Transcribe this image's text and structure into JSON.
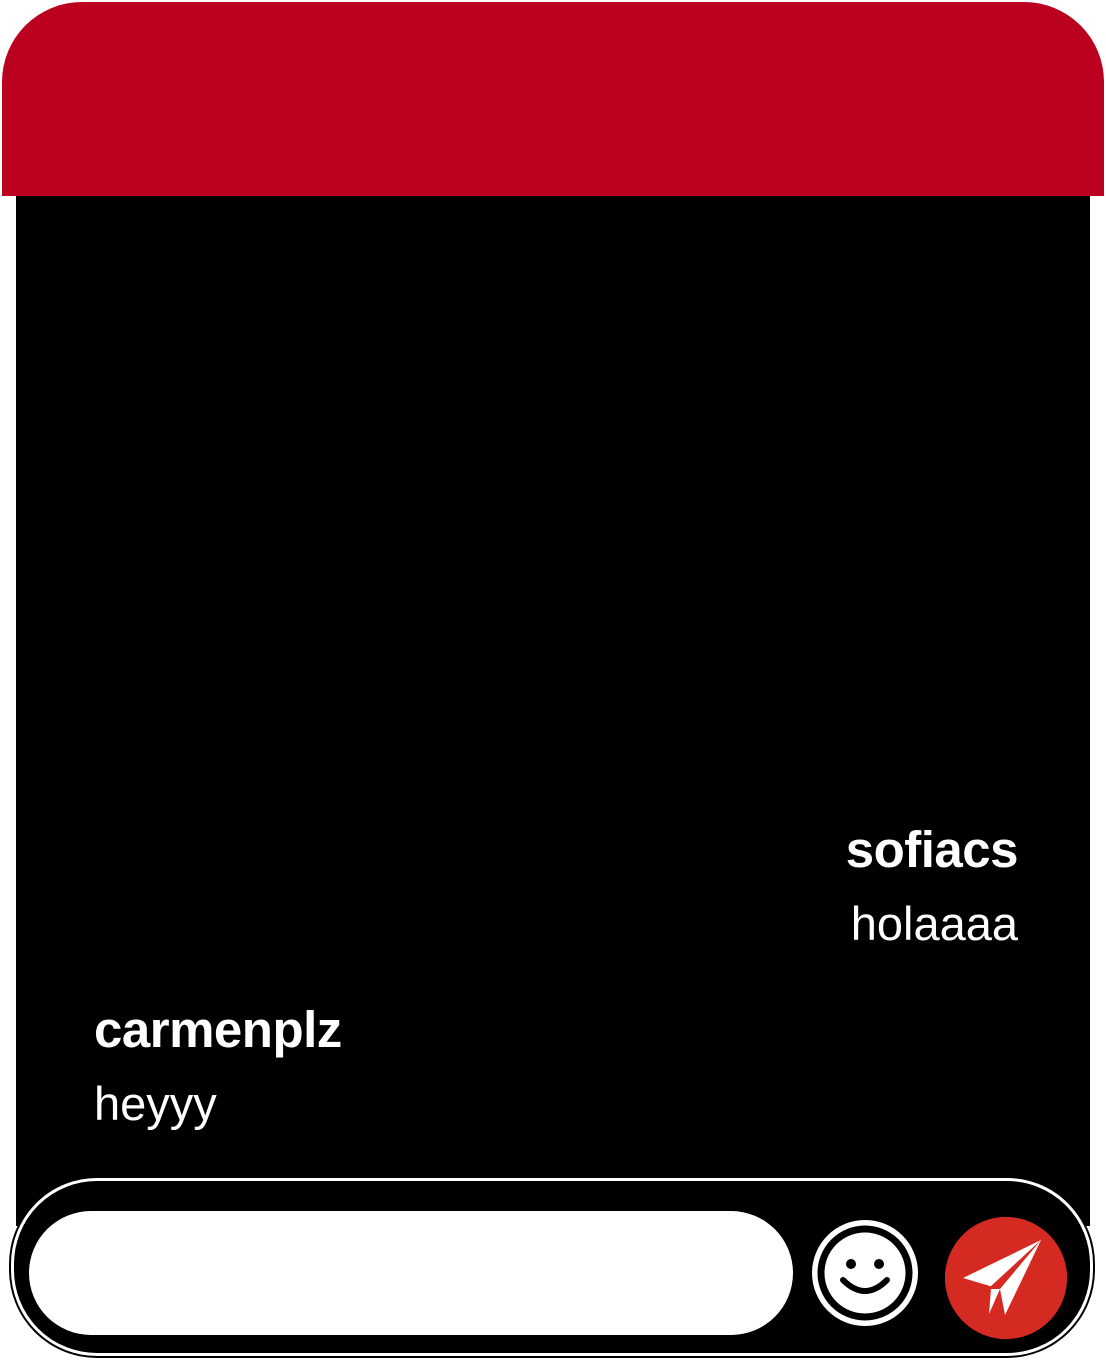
{
  "colors": {
    "header": "#bb0020",
    "panel": "#000000",
    "send_button": "#d42a21",
    "text": "#ffffff"
  },
  "messages": [
    {
      "author": "sofiacs",
      "text": "holaaaa",
      "align": "right"
    },
    {
      "author": "carmenplz",
      "text": "heyyy",
      "align": "left"
    }
  ],
  "composer": {
    "input_value": "",
    "placeholder": "",
    "emoji_icon": "smiley-face-icon",
    "send_icon": "paper-plane-icon"
  }
}
